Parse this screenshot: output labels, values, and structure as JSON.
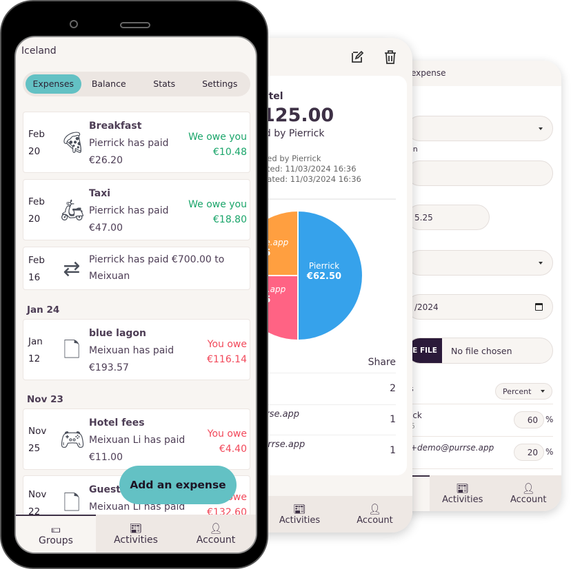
{
  "back_screen": {
    "header_title": "expense",
    "label_description": "on",
    "amount_value": "5.25",
    "date_value": "/2024",
    "file_button": "E FILE",
    "file_status": "No file chosen",
    "split_label": "s",
    "split_mode": "Percent",
    "participants": [
      {
        "name": "ick",
        "sub": "5",
        "value": "60",
        "unit": "%"
      },
      {
        "name": "+demo@purrse.app",
        "value": "20",
        "unit": "%"
      }
    ],
    "nav": {
      "activities": "Activities",
      "account": "Account"
    }
  },
  "middle_screen": {
    "title": "otel",
    "amount": "125.00",
    "paid_by": "id by Pierrick",
    "added_by": "ded by Pierrick",
    "created": "ated: 11/03/2024 16:36",
    "updated": "dated: 11/03/2024 16:36",
    "chart_data": {
      "type": "pie",
      "slices": [
        {
          "label": "Pierrick",
          "amount": "€62.50",
          "value": 62.5,
          "color": "#36a2eb"
        },
        {
          "label": "o@purrse.app",
          "amount": "31.25",
          "value": 31.25,
          "color": "#ff6384"
        },
        {
          "label": "n2@purrse.app",
          "amount": "31.25",
          "value": 31.25,
          "color": "#ff9f40"
        }
      ]
    },
    "table_header_share": "Share",
    "rows": [
      {
        "name": "",
        "share": "2"
      },
      {
        "name": "rrse.app",
        "share": "1"
      },
      {
        "name": "urrse.app",
        "share": "1"
      }
    ],
    "nav": {
      "activities": "Activities",
      "account": "Account"
    }
  },
  "front_screen": {
    "group_name": "Iceland",
    "tabs": [
      "Expenses",
      "Balance",
      "Stats",
      "Settings"
    ],
    "active_tab": "Expenses",
    "expenses": [
      {
        "month": "Feb",
        "day": "20",
        "icon": "pizza-icon",
        "title": "Breakfast",
        "payer": "Pierrick has paid",
        "amount": "€26.20",
        "status": "We owe you",
        "balance": "€10.48"
      },
      {
        "month": "Feb",
        "day": "20",
        "icon": "taxi-icon",
        "title": "Taxi",
        "payer": "Pierrick has paid",
        "amount": "€47.00",
        "status": "We owe you",
        "balance": "€18.80"
      },
      {
        "month": "Feb",
        "day": "16",
        "icon": "transfer-icon",
        "text1": "Pierrick has paid €700.00 to",
        "text2": "Meixuan"
      },
      {
        "month": "Jan",
        "day": "12",
        "icon": "document-icon",
        "title": "blue lagon",
        "payer": "Meixuan has paid",
        "amount": "€193.57",
        "status": "You owe",
        "balance": "€116.14"
      },
      {
        "month": "Nov",
        "day": "25",
        "icon": "gamepad-icon",
        "title": "Hotel fees",
        "payer": "Meixuan Li has paid",
        "amount": "€11.00",
        "status": "You owe",
        "balance": "€4.40"
      },
      {
        "month": "Nov",
        "day": "22",
        "icon": "document-icon",
        "title": "Guesth",
        "payer": "Meixuan Li has paid",
        "status": "owe",
        "balance": "€132.60"
      }
    ],
    "sections": [
      "Jan 24",
      "Nov 23"
    ],
    "fab_label": "Add an expense",
    "nav": {
      "groups": "Groups",
      "activities": "Activities",
      "account": "Account"
    },
    "colors": {
      "accent": "#63c1c4",
      "positive": "#1aa56a",
      "negative": "#f2485a"
    }
  }
}
